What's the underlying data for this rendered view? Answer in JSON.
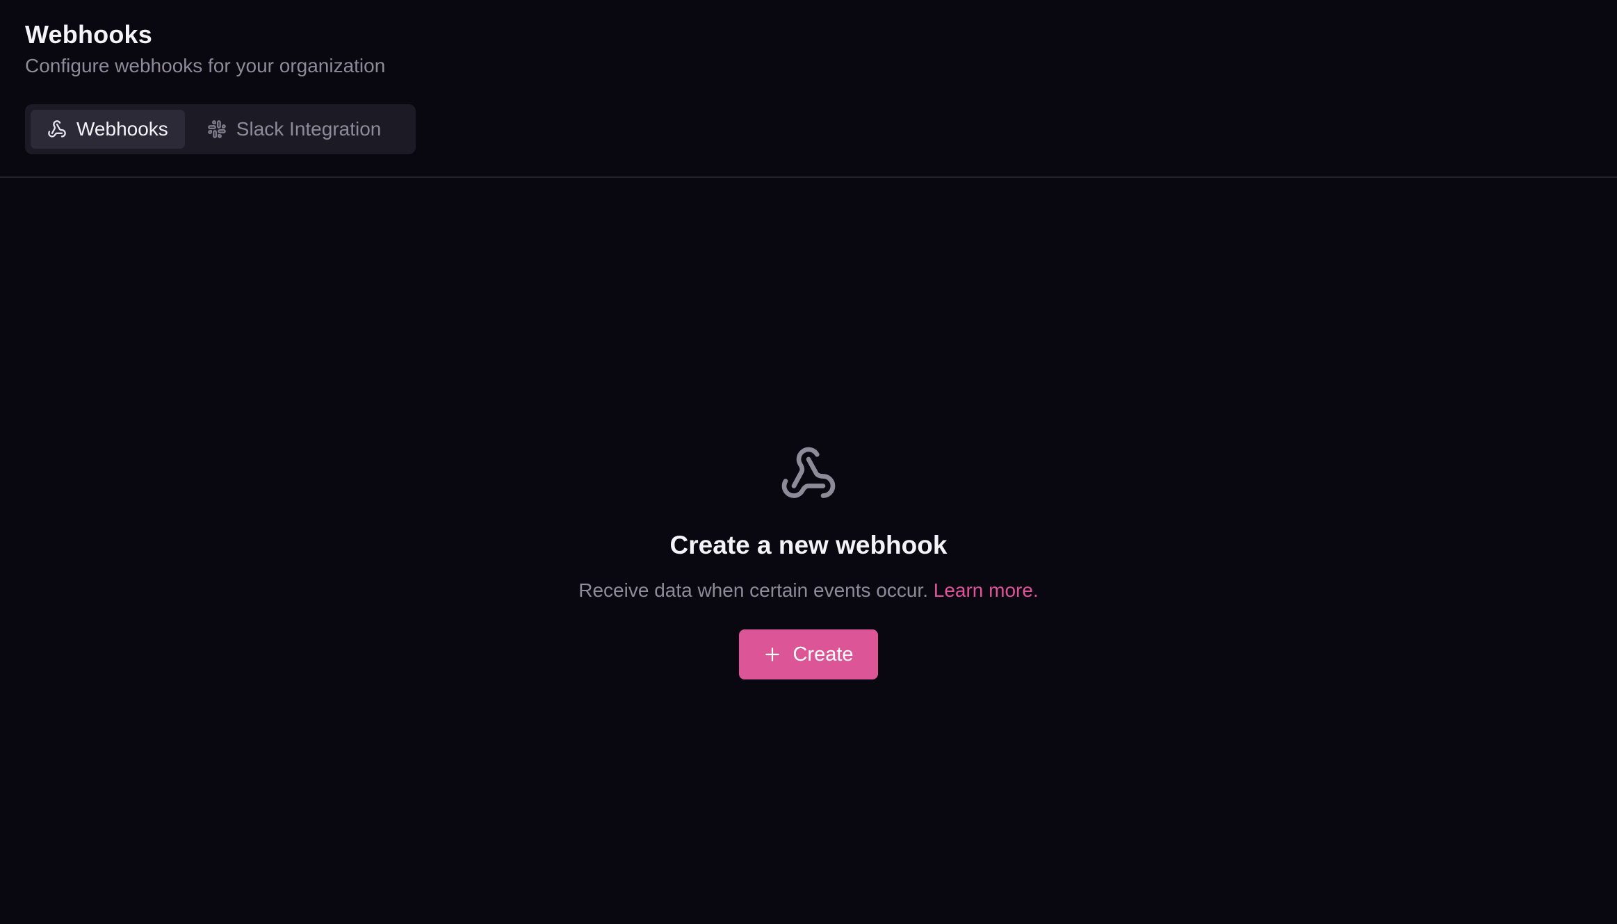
{
  "header": {
    "title": "Webhooks",
    "subtitle": "Configure webhooks for your organization"
  },
  "tabs": [
    {
      "label": "Webhooks",
      "icon": "webhook-icon",
      "active": true
    },
    {
      "label": "Slack Integration",
      "icon": "slack-icon",
      "active": false
    }
  ],
  "empty_state": {
    "icon": "webhook-icon",
    "title": "Create a new webhook",
    "description": "Receive data when certain events occur.",
    "link_label": "Learn more.",
    "button_label": "Create",
    "button_icon": "plus-icon"
  },
  "colors": {
    "background": "#09070f",
    "accent": "#db5597",
    "link": "#e0529a",
    "muted_text": "#8e8b99",
    "tab_bar": "#1c1a25",
    "tab_active": "#2c2a36"
  }
}
